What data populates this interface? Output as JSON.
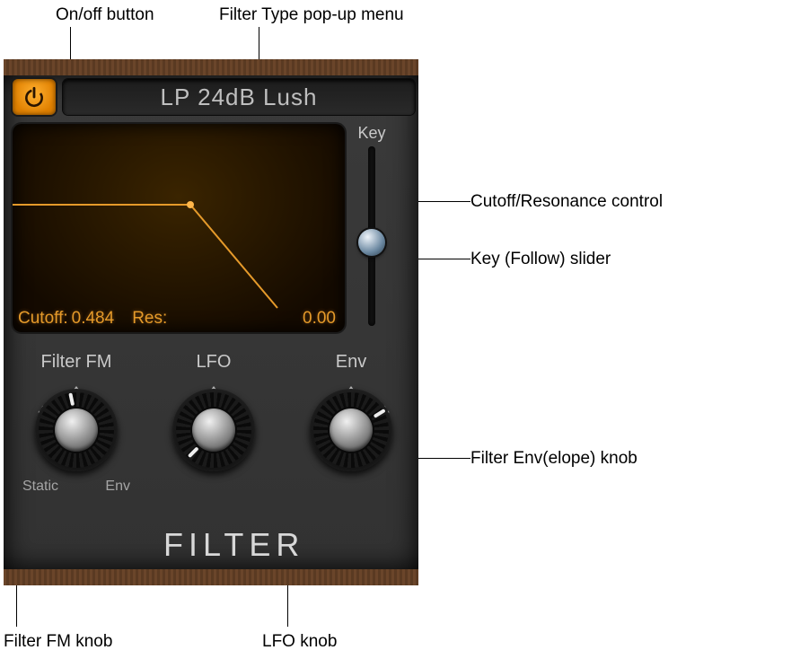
{
  "callouts": {
    "onoff": "On/off button",
    "filterType": "Filter Type pop-up menu",
    "cutoffRes": "Cutoff/Resonance control",
    "keySlider": "Key (Follow) slider",
    "envKnob": "Filter Env(elope) knob",
    "fmKnob": "Filter FM knob",
    "lfoKnob": "LFO knob"
  },
  "header": {
    "filterType": "LP 24dB Lush"
  },
  "display": {
    "cutoffLabel": "Cutoff:",
    "cutoffValue": "0.484",
    "resLabel": "Res:",
    "resValue": "0.00"
  },
  "keySlider": {
    "label": "Key"
  },
  "knobs": {
    "fm": {
      "label": "Filter FM",
      "subLeft": "Static",
      "subRight": "Env"
    },
    "lfo": {
      "label": "LFO"
    },
    "env": {
      "label": "Env"
    }
  },
  "sectionTitle": "FILTER"
}
